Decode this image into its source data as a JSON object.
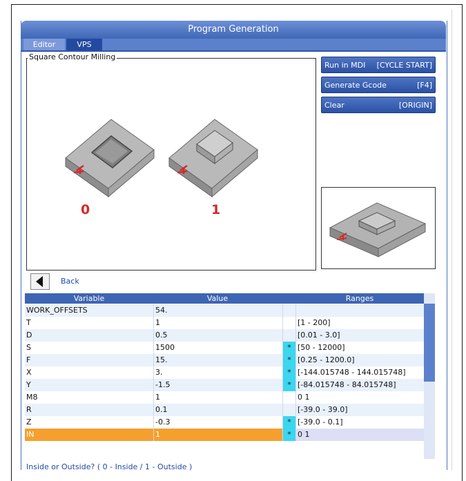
{
  "window": {
    "title": "Program Generation"
  },
  "tabs": [
    {
      "label": "Editor"
    },
    {
      "label": "VPS"
    }
  ],
  "group": {
    "title": "Square Contour Milling"
  },
  "options": [
    {
      "label": "0"
    },
    {
      "label": "1"
    }
  ],
  "buttons": {
    "run": {
      "label": "Run in MDI",
      "key": "[CYCLE START]"
    },
    "generate": {
      "label": "Generate Gcode",
      "key": "[F4]"
    },
    "clear": {
      "label": "Clear",
      "key": "[ORIGIN]"
    }
  },
  "nav": {
    "back_label": "Back"
  },
  "table": {
    "headers": {
      "variable": "Variable",
      "value": "Value",
      "ranges": "Ranges"
    },
    "rows": [
      {
        "variable": "WORK_OFFSETS",
        "value": "54.",
        "star": "",
        "range": ""
      },
      {
        "variable": "T",
        "value": "1",
        "star": "",
        "range": "[1 - 200]"
      },
      {
        "variable": "D",
        "value": "0.5",
        "star": "",
        "range": "[0.01 - 3.0]"
      },
      {
        "variable": "S",
        "value": "1500",
        "star": "*",
        "range": "[50 - 12000]"
      },
      {
        "variable": "F",
        "value": "15.",
        "star": "*",
        "range": "[0.25 - 1200.0]"
      },
      {
        "variable": "X",
        "value": "3.",
        "star": "*",
        "range": "[-144.015748 - 144.015748]"
      },
      {
        "variable": "Y",
        "value": "-1.5",
        "star": "*",
        "range": "[-84.015748 - 84.015748]"
      },
      {
        "variable": "M8",
        "value": "1",
        "star": "",
        "range": "0 1"
      },
      {
        "variable": "R",
        "value": "0.1",
        "star": "",
        "range": "[-39.0 - 39.0]"
      },
      {
        "variable": "Z",
        "value": "-0.3",
        "star": "*",
        "range": "[-39.0 - 0.1]"
      },
      {
        "variable": "IN",
        "value": "1",
        "star": "*",
        "range": "0 1"
      }
    ]
  },
  "hint": "Inside or Outside? ( 0 - Inside / 1 - Outside )",
  "colors": {
    "accent": "#3e65b3",
    "selected_row": "#f5a02e",
    "required_marker": "#3cd6f0",
    "option_number": "#d32a2a"
  }
}
